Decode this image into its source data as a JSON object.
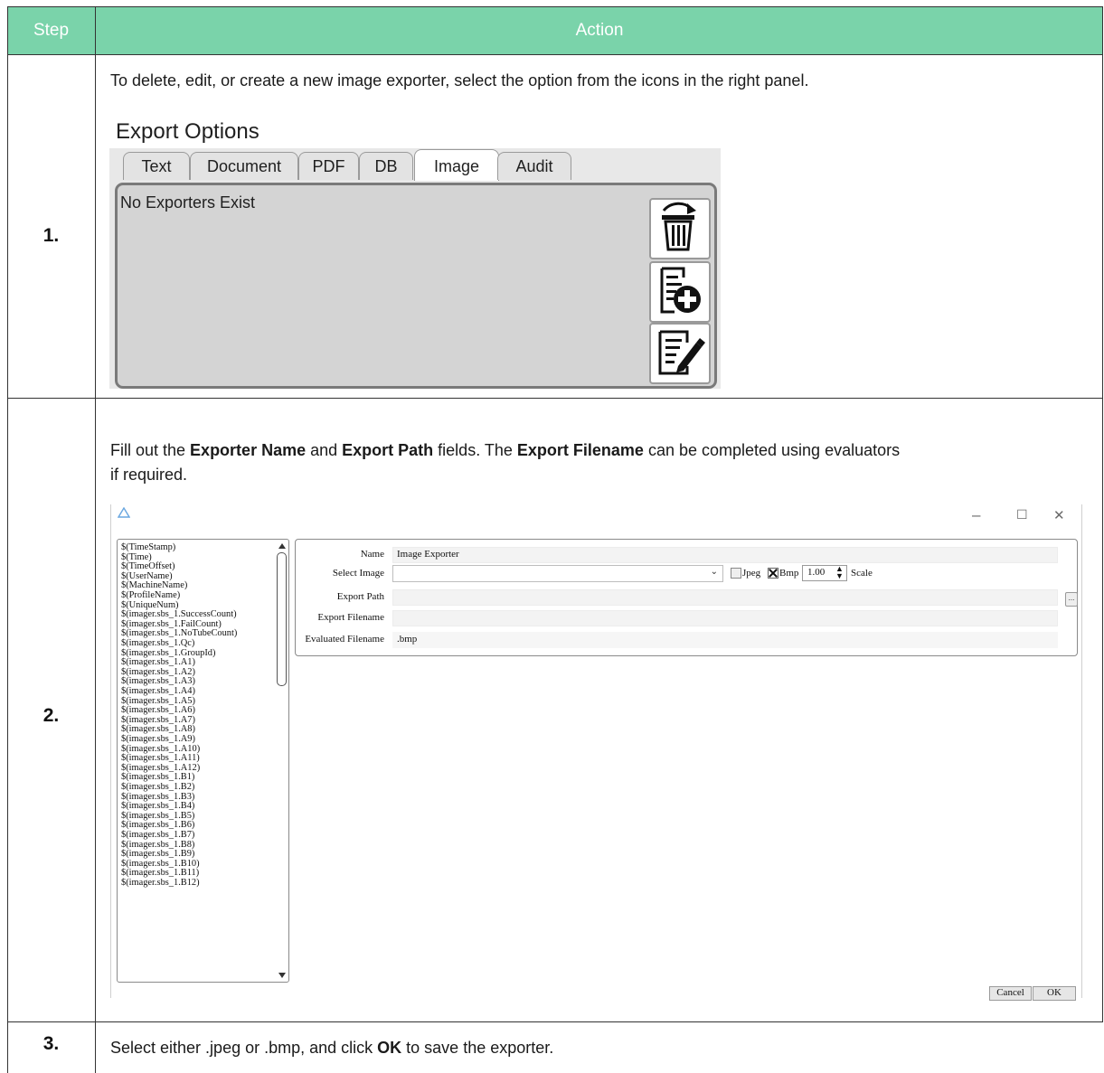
{
  "table": {
    "header_step": "Step",
    "header_action": "Action",
    "rows": [
      {
        "step": "1.",
        "text": "To delete, edit, or create a new image exporter, select the option from the icons in the right panel."
      },
      {
        "step": "2.",
        "text_parts": [
          "Fill out the ",
          "Exporter Name",
          " and ",
          "Export Path",
          " fields. The ",
          "Export Filename",
          " can be completed using evaluators",
          "if required."
        ]
      },
      {
        "step": "3.",
        "text_parts": [
          "Select either .jpeg or .bmp, and click ",
          "OK",
          " to save the exporter."
        ]
      }
    ]
  },
  "export_options": {
    "title": "Export Options",
    "tabs": [
      "Text",
      "Document",
      "PDF",
      "DB",
      "Image",
      "Audit"
    ],
    "active_tab": "Image",
    "message": "No Exporters Exist",
    "icons": [
      "delete-exporter-icon",
      "add-exporter-icon",
      "edit-exporter-icon"
    ]
  },
  "dialog": {
    "window_controls": [
      "–",
      "☐",
      "✕"
    ],
    "evaluators": [
      "$(TimeStamp)",
      "$(Time)",
      "$(TimeOffset)",
      "$(UserName)",
      "$(MachineName)",
      "$(ProfileName)",
      "$(UniqueNum)",
      "$(imager.sbs_1.SuccessCount)",
      "$(imager.sbs_1.FailCount)",
      "$(imager.sbs_1.NoTubeCount)",
      "$(imager.sbs_1.Qc)",
      "$(imager.sbs_1.GroupId)",
      "$(imager.sbs_1.A1)",
      "$(imager.sbs_1.A2)",
      "$(imager.sbs_1.A3)",
      "$(imager.sbs_1.A4)",
      "$(imager.sbs_1.A5)",
      "$(imager.sbs_1.A6)",
      "$(imager.sbs_1.A7)",
      "$(imager.sbs_1.A8)",
      "$(imager.sbs_1.A9)",
      "$(imager.sbs_1.A10)",
      "$(imager.sbs_1.A11)",
      "$(imager.sbs_1.A12)",
      "$(imager.sbs_1.B1)",
      "$(imager.sbs_1.B2)",
      "$(imager.sbs_1.B3)",
      "$(imager.sbs_1.B4)",
      "$(imager.sbs_1.B5)",
      "$(imager.sbs_1.B6)",
      "$(imager.sbs_1.B7)",
      "$(imager.sbs_1.B8)",
      "$(imager.sbs_1.B9)",
      "$(imager.sbs_1.B10)",
      "$(imager.sbs_1.B11)",
      "$(imager.sbs_1.B12)"
    ],
    "form": {
      "name_label": "Name",
      "name_value": "Image Exporter",
      "select_image_label": "Select Image",
      "select_image_value": "",
      "jpeg_label": "Jpeg",
      "jpeg_checked": false,
      "bmp_label": "Bmp",
      "bmp_checked": true,
      "scale_value": "1.00",
      "scale_label": "Scale",
      "export_path_label": "Export Path",
      "export_path_value": "",
      "browse_label": "...",
      "export_filename_label": "Export Filename",
      "export_filename_value": "",
      "evaluated_filename_label": "Evaluated Filename",
      "evaluated_filename_value": ".bmp"
    },
    "cancel_label": "Cancel",
    "ok_label": "OK"
  }
}
